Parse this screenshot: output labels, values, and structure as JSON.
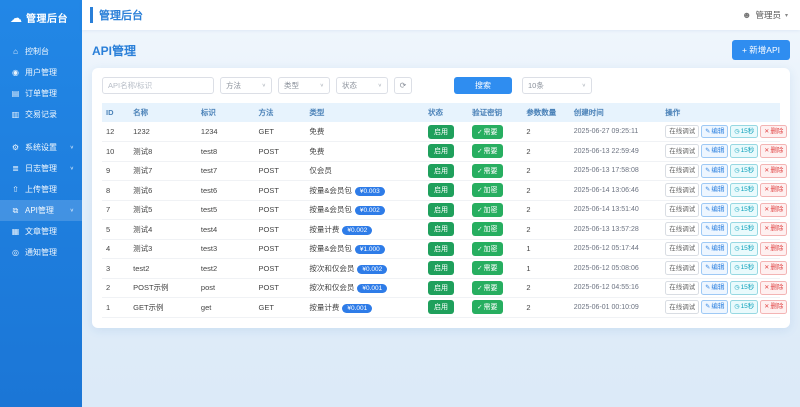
{
  "icons": {
    "cloud": "☁",
    "user": "☻",
    "chevron_down": "∨",
    "caret": "▾",
    "refresh": "⟳",
    "check": "✓",
    "edit": "✎",
    "delete": "✕",
    "clock": "◷",
    "dashboard": "⌂",
    "users": "◉",
    "orders": "▤",
    "transactions": "▥",
    "gear": "⚙",
    "logs": "≣",
    "upload": "⇧",
    "api": "⧉",
    "document": "▦",
    "bell": "◎"
  },
  "sidebar": {
    "logo": "管理后台",
    "items": [
      {
        "label": "控制台",
        "icon": "dashboard"
      },
      {
        "label": "用户管理",
        "icon": "users"
      },
      {
        "label": "订单管理",
        "icon": "orders"
      },
      {
        "label": "交易记录",
        "icon": "transactions"
      },
      {
        "label": "系统设置",
        "icon": "gear",
        "expandable": true,
        "group_start": true
      },
      {
        "label": "日志管理",
        "icon": "logs",
        "expandable": true
      },
      {
        "label": "上传管理",
        "icon": "upload"
      },
      {
        "label": "API管理",
        "icon": "api",
        "expandable": true,
        "active": true
      },
      {
        "label": "文章管理",
        "icon": "document"
      },
      {
        "label": "通知管理",
        "icon": "bell"
      }
    ]
  },
  "header": {
    "title": "管理后台",
    "user": "管理员"
  },
  "page": {
    "title": "API管理",
    "add_button": "+ 新增API"
  },
  "filters": {
    "search_placeholder": "API名称/标识",
    "method_label": "方法",
    "type_label": "类型",
    "status_label": "状态",
    "search_button": "搜索",
    "page_size": "10条"
  },
  "table": {
    "headers": [
      "ID",
      "名称",
      "标识",
      "方法",
      "类型",
      "状态",
      "验证密钥",
      "参数数量",
      "创建时间",
      "操作"
    ],
    "actions": {
      "debug": "在线调试",
      "edit": "编辑",
      "cache": "15秒",
      "delete": "删除"
    },
    "rows": [
      {
        "id": 12,
        "name": "1232",
        "slug": "1234",
        "method": "GET",
        "type": "免费",
        "price": null,
        "status": "启用",
        "verify": "需要",
        "params": 2,
        "time": "2025-06-27 09:25:11"
      },
      {
        "id": 10,
        "name": "测试8",
        "slug": "test8",
        "method": "POST",
        "type": "免费",
        "price": null,
        "status": "启用",
        "verify": "需要",
        "params": 2,
        "time": "2025-06-13 22:59:49"
      },
      {
        "id": 9,
        "name": "测试7",
        "slug": "test7",
        "method": "POST",
        "type": "仅会员",
        "price": null,
        "status": "启用",
        "verify": "需要",
        "params": 2,
        "time": "2025-06-13 17:58:08"
      },
      {
        "id": 8,
        "name": "测试6",
        "slug": "test6",
        "method": "POST",
        "type": "按量&会员包",
        "price": "¥0.003",
        "status": "启用",
        "verify": "加密",
        "params": 2,
        "time": "2025-06-14 13:06:46"
      },
      {
        "id": 7,
        "name": "测试5",
        "slug": "test5",
        "method": "POST",
        "type": "按量&会员包",
        "price": "¥0.002",
        "status": "启用",
        "verify": "加密",
        "params": 2,
        "time": "2025-06-14 13:51:40"
      },
      {
        "id": 5,
        "name": "测试4",
        "slug": "test4",
        "method": "POST",
        "type": "按量计费",
        "price": "¥0.002",
        "status": "启用",
        "verify": "加密",
        "params": 2,
        "time": "2025-06-13 13:57:28"
      },
      {
        "id": 4,
        "name": "测试3",
        "slug": "test3",
        "method": "POST",
        "type": "按量&会员包",
        "price": "¥1.000",
        "status": "启用",
        "verify": "加密",
        "params": 1,
        "time": "2025-06-12 05:17:44"
      },
      {
        "id": 3,
        "name": "test2",
        "slug": "test2",
        "method": "POST",
        "type": "按次和仅会员",
        "price": "¥0.002",
        "status": "启用",
        "verify": "需要",
        "params": 1,
        "time": "2025-06-12 05:08:06"
      },
      {
        "id": 2,
        "name": "POST示例",
        "slug": "post",
        "method": "POST",
        "type": "按次和仅会员",
        "price": "¥0.001",
        "status": "启用",
        "verify": "需要",
        "params": 2,
        "time": "2025-06-12 04:55:16"
      },
      {
        "id": 1,
        "name": "GET示例",
        "slug": "get",
        "method": "GET",
        "type": "按量计费",
        "price": "¥0.001",
        "status": "启用",
        "verify": "需要",
        "params": 2,
        "time": "2025-06-01 00:10:09"
      }
    ]
  }
}
